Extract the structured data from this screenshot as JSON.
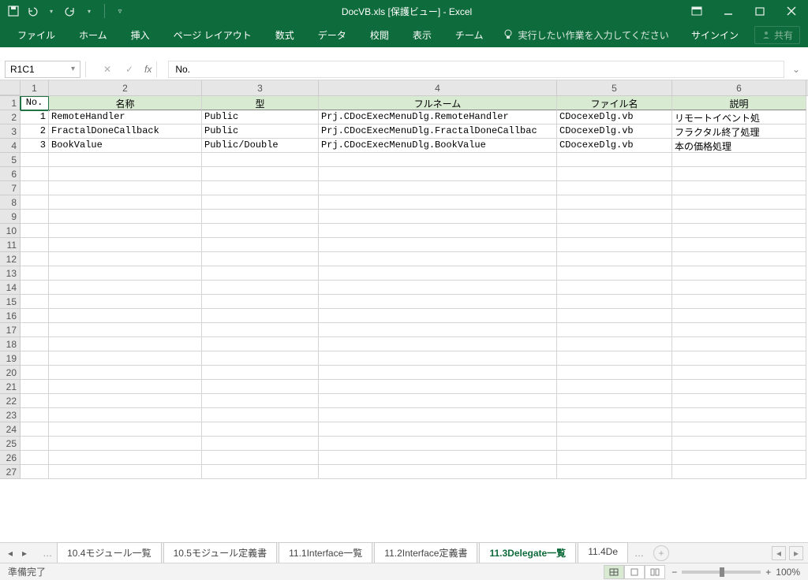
{
  "title": "DocVB.xls  [保護ビュー] - Excel",
  "ribbon": {
    "tabs": [
      "ファイル",
      "ホーム",
      "挿入",
      "ページ レイアウト",
      "数式",
      "データ",
      "校閲",
      "表示",
      "チーム"
    ],
    "tellme": "実行したい作業を入力してください",
    "signin": "サインイン",
    "share": "共有"
  },
  "namebox": "R1C1",
  "formula": "No.",
  "col_numbers": [
    "1",
    "2",
    "3",
    "4",
    "5",
    "6"
  ],
  "headers": [
    "No.",
    "名称",
    "型",
    "フルネーム",
    "ファイル名",
    "説明"
  ],
  "rows": [
    {
      "no": "1",
      "name": "RemoteHandler",
      "type": "Public",
      "full": "Prj.CDocExecMenuDlg.RemoteHandler",
      "file": "CDocexeDlg.vb",
      "desc": "リモートイベント処"
    },
    {
      "no": "2",
      "name": "FractalDoneCallback",
      "type": "Public",
      "full": "Prj.CDocExecMenuDlg.FractalDoneCallbac",
      "file": "CDocexeDlg.vb",
      "desc": "フラクタル終了処理"
    },
    {
      "no": "3",
      "name": "BookValue",
      "type": "Public/Double",
      "full": "Prj.CDocExecMenuDlg.BookValue",
      "file": "CDocexeDlg.vb",
      "desc": "本の価格処理"
    }
  ],
  "row_count": 27,
  "sheets": [
    "10.4モジュール一覧",
    "10.5モジュール定義書",
    "11.1Interface一覧",
    "11.2Interface定義書",
    "11.3Delegate一覧",
    "11.4De"
  ],
  "active_sheet": 4,
  "status": "準備完了",
  "zoom": "100%"
}
